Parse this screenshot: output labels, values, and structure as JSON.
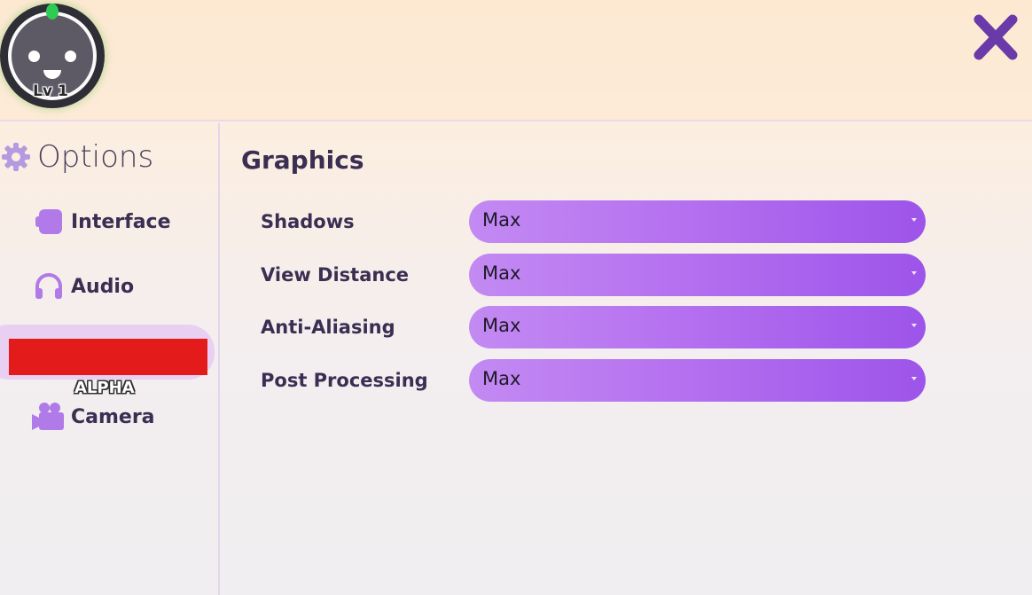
{
  "header": {
    "level_text": "Lv 1"
  },
  "sidebar": {
    "title": "Options",
    "items": [
      {
        "label": "Interface",
        "icon": "interface-icon"
      },
      {
        "label": "Audio",
        "icon": "headphones-icon"
      },
      {
        "label": "Camera",
        "icon": "video-camera-icon"
      }
    ],
    "alpha_badge": "ALPHA"
  },
  "main": {
    "section_title": "Graphics",
    "settings": [
      {
        "label": "Shadows",
        "value": "Max"
      },
      {
        "label": "View Distance",
        "value": "Max"
      },
      {
        "label": "Anti-Aliasing",
        "value": "Max"
      },
      {
        "label": "Post Processing",
        "value": "Max"
      }
    ]
  },
  "colors": {
    "accent": "#a45ded",
    "dropdown_start": "#c38af2",
    "dropdown_end": "#9d54ea",
    "text_dark": "#3a2f52",
    "close_icon": "#6a3aa8"
  }
}
